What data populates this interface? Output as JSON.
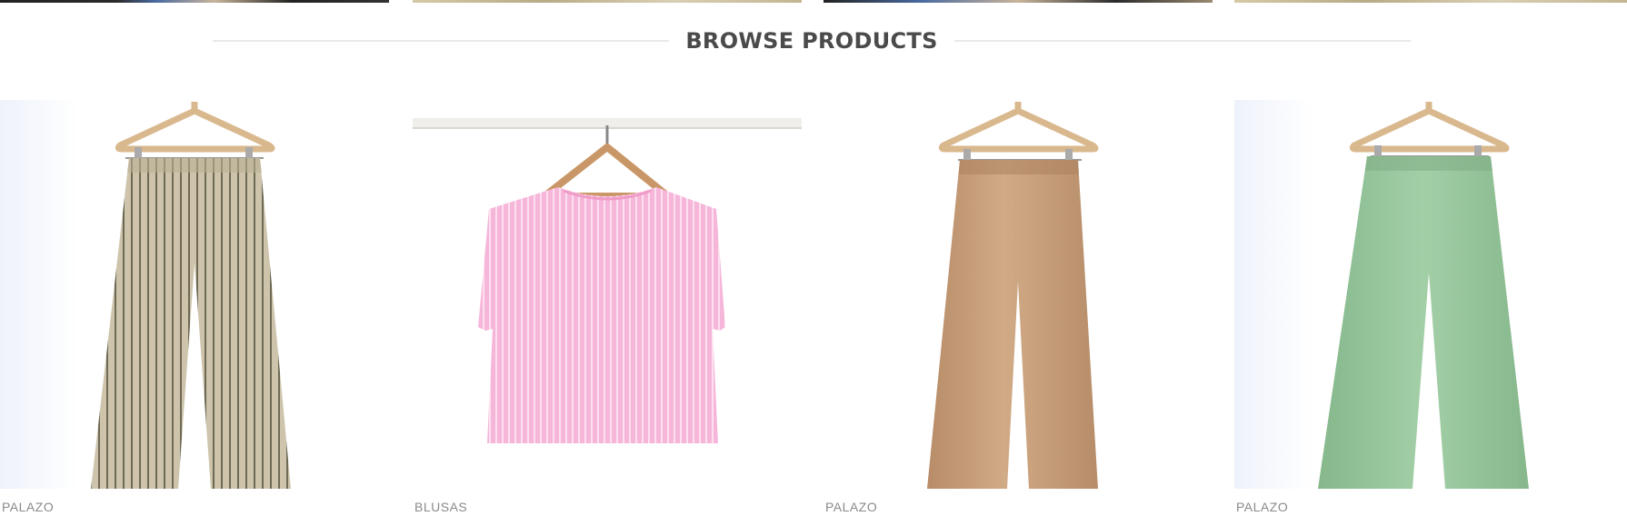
{
  "section": {
    "title": "BROWSE PRODUCTS"
  },
  "products": [
    {
      "category": "PALAZO",
      "icon": "striped-palazo-pants-image",
      "color": "#c9bfa6"
    },
    {
      "category": "BLUSAS",
      "icon": "pink-striped-blouse-image",
      "color": "#f4b6d8"
    },
    {
      "category": "PALAZO",
      "icon": "camel-palazo-pants-image",
      "color": "#c9a07c"
    },
    {
      "category": "PALAZO",
      "icon": "green-palazo-pants-image",
      "color": "#9cc7a0"
    }
  ],
  "colors": {
    "title": "#4a4a4a",
    "rule": "#e9e9e9",
    "category": "#8a8a8a"
  }
}
